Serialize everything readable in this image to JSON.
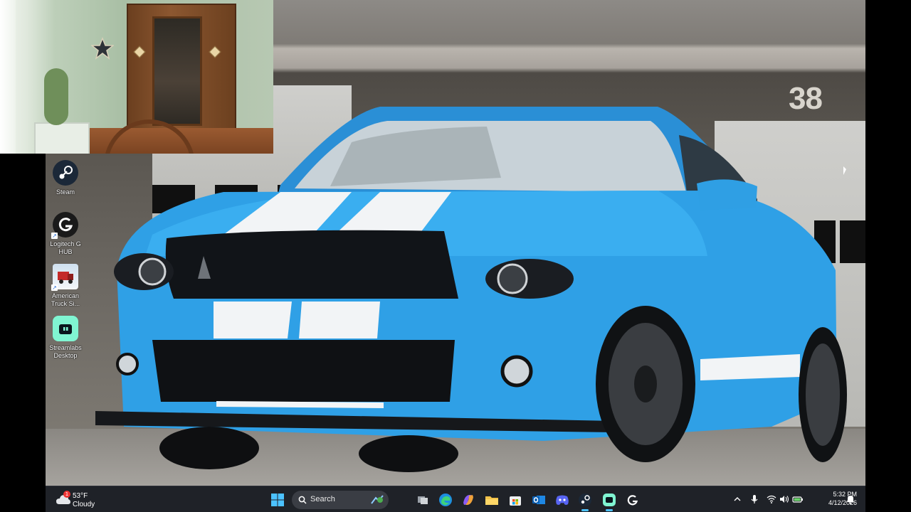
{
  "desktop": {
    "background_colors": {
      "car_blue": "#2fa0e6",
      "stripe": "#f2f4f6",
      "garage": "#d0d0cc"
    },
    "wall_number": "38",
    "icons": [
      {
        "label_line1": "Steam",
        "label_line2": "",
        "icon": "steam-icon"
      },
      {
        "label_line1": "Logitech G",
        "label_line2": "HUB",
        "icon": "logitech-g-icon"
      },
      {
        "label_line1": "American",
        "label_line2": "Truck Si...",
        "icon": "american-truck-simulator-icon"
      },
      {
        "label_line1": "Streamlabs",
        "label_line2": "Desktop",
        "icon": "streamlabs-icon"
      }
    ]
  },
  "taskbar": {
    "weather": {
      "temperature": "53°F",
      "condition": "Cloudy",
      "badge": "1"
    },
    "search_label": "Search",
    "pinned_apps": [
      "start-icon",
      "search-icon",
      "widgets-icon",
      "task-view-icon",
      "edge-icon",
      "copilot-icon",
      "file-explorer-icon",
      "microsoft-store-icon",
      "outlook-icon",
      "discord-icon",
      "steam-icon",
      "streamlabs-icon",
      "logitech-g-icon"
    ],
    "clock": {
      "time": "5:32 PM",
      "date": "4/12/2026"
    },
    "accent": "#4cc2ff"
  }
}
